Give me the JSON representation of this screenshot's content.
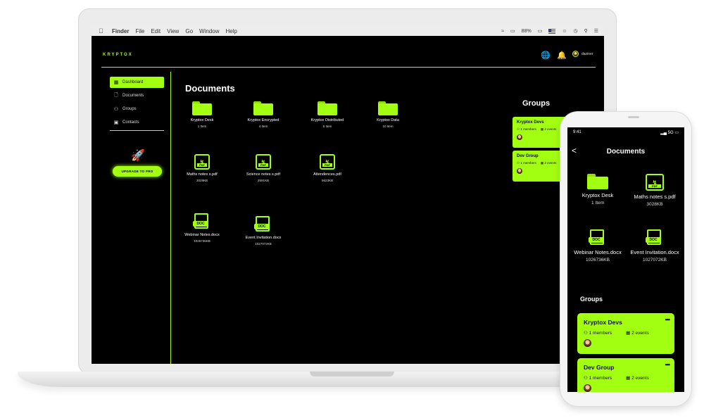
{
  "menubar": {
    "items": [
      "Finder",
      "File",
      "Edit",
      "View",
      "Go",
      "Window",
      "Help"
    ],
    "battery": "88%"
  },
  "app": {
    "brand": "KRYPTOX",
    "username": "daziner",
    "accent_color": "#a3ff12"
  },
  "sidebar": {
    "items": [
      {
        "label": "Dashboard",
        "icon": "dashboard-icon",
        "active": true
      },
      {
        "label": "Documents",
        "icon": "documents-icon",
        "active": false
      },
      {
        "label": "Groups",
        "icon": "groups-icon",
        "active": false
      },
      {
        "label": "Contacts",
        "icon": "contacts-icon",
        "active": false
      }
    ],
    "upgrade_label": "UPGRADE TO PRO"
  },
  "documents": {
    "title": "Documents",
    "folders": [
      {
        "name": "Kryptox Desk",
        "meta": "1 Item"
      },
      {
        "name": "Kryptox Encrypted",
        "meta": "4 Item"
      },
      {
        "name": "Kryptox Distributed",
        "meta": "5 Item"
      },
      {
        "name": "Kryptox Data",
        "meta": "10 Item"
      }
    ],
    "pdfs": [
      {
        "name": "Maths notes s.pdf",
        "meta": "3028KB"
      },
      {
        "name": "Science notes s.pdf",
        "meta": "2591KB"
      },
      {
        "name": "Attendences.pdf",
        "meta": "5623KB"
      }
    ],
    "docs": [
      {
        "name": "Webinar Notes.docx",
        "meta": "1026736KB"
      },
      {
        "name": "Event Invitation.docx",
        "meta": "1027072KB"
      }
    ],
    "doc_tag": "DOC",
    "pdf_tag": "PDF"
  },
  "groups": {
    "title": "Groups",
    "items": [
      {
        "name": "Kryptox Devs",
        "members": "1 members",
        "events": "2 events"
      },
      {
        "name": "Dev Group",
        "members": "1 members",
        "events": "2 events"
      }
    ]
  },
  "phone": {
    "time": "9:41",
    "signal": "5G",
    "back": "<",
    "title": "Documents",
    "items": [
      {
        "name": "Kryptox Desk",
        "meta": "1 Item",
        "kind": "folder"
      },
      {
        "name": "Maths notes s.pdf",
        "meta": "3028KB",
        "kind": "pdf"
      },
      {
        "name": "Webinar Notes.docx",
        "meta": "1026736KB",
        "kind": "doc"
      },
      {
        "name": "Event Invitation.docx",
        "meta": "1027072KB",
        "kind": "doc"
      }
    ],
    "groups_title": "Groups",
    "more": "•••"
  }
}
